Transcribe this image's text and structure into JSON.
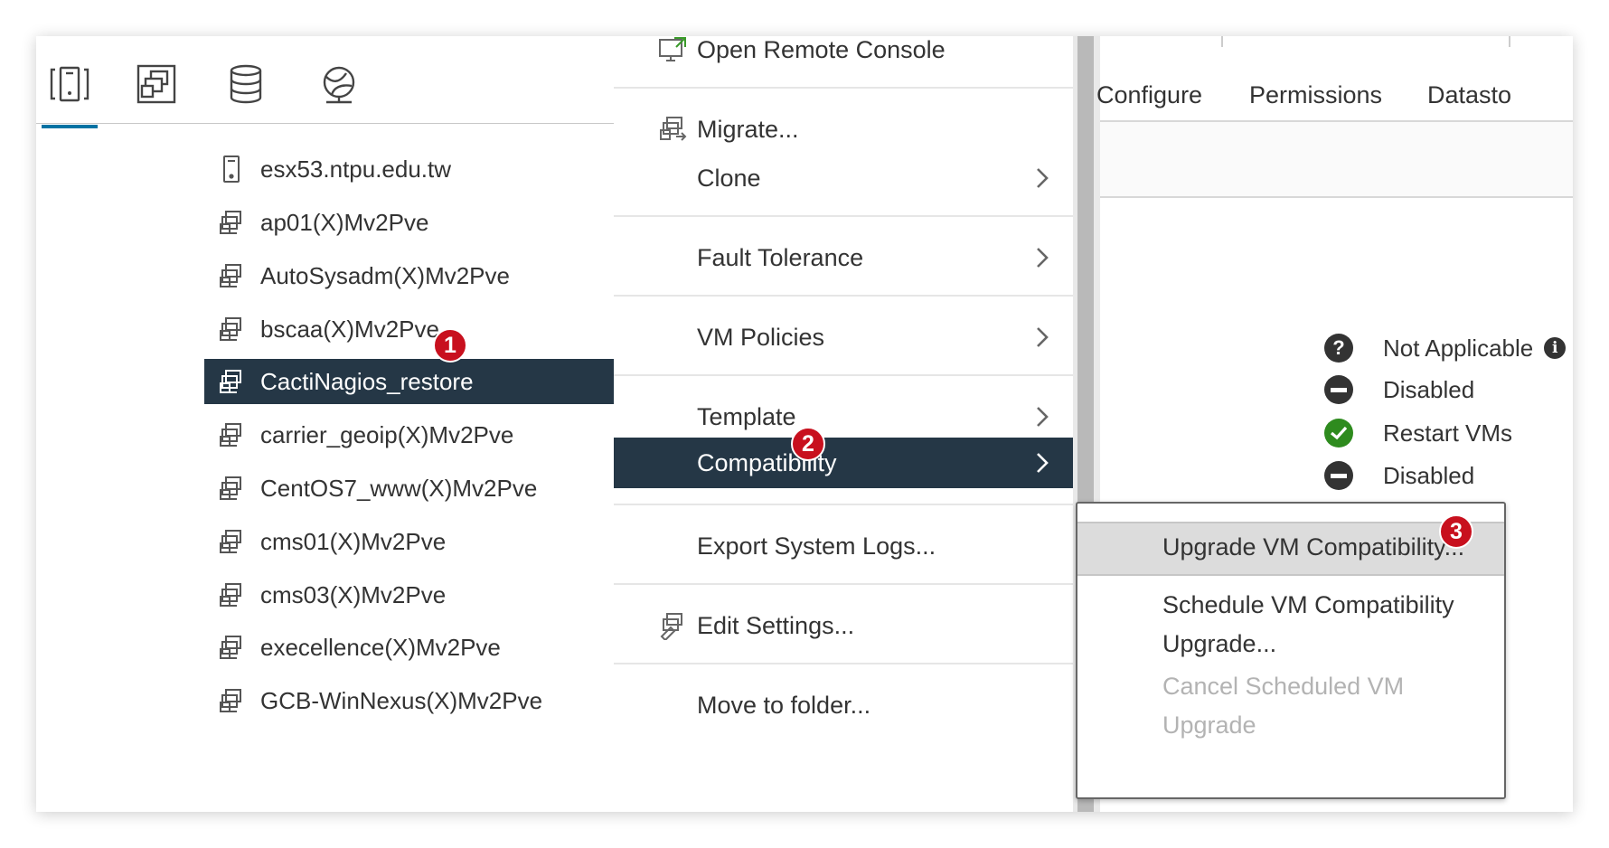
{
  "navigator": {
    "tabs": [
      {
        "name": "hosts-and-clusters",
        "icon": "hosts-clusters-icon"
      },
      {
        "name": "vms-and-templates",
        "icon": "vms-templates-icon"
      },
      {
        "name": "storage",
        "icon": "database-icon"
      },
      {
        "name": "networking",
        "icon": "network-icon"
      }
    ],
    "items": [
      {
        "label": "esx53.ntpu.edu.tw",
        "icon": "host-icon"
      },
      {
        "label": "ap01(X)Mv2Pve",
        "icon": "vm-icon"
      },
      {
        "label": "AutoSysadm(X)Mv2Pve",
        "icon": "vm-icon"
      },
      {
        "label": "bscaa(X)Mv2Pve",
        "icon": "vm-icon"
      },
      {
        "label": "CactiNagios_restore",
        "icon": "vm-icon",
        "selected": true
      },
      {
        "label": "carrier_geoip(X)Mv2Pve",
        "icon": "vm-icon"
      },
      {
        "label": "CentOS7_www(X)Mv2Pve",
        "icon": "vm-icon"
      },
      {
        "label": "cms01(X)Mv2Pve",
        "icon": "vm-icon"
      },
      {
        "label": "cms03(X)Mv2Pve",
        "icon": "vm-icon"
      },
      {
        "label": "execellence(X)Mv2Pve",
        "icon": "vm-icon"
      },
      {
        "label": "GCB-WinNexus(X)Mv2Pve",
        "icon": "vm-icon"
      }
    ]
  },
  "context_menu": {
    "items": [
      {
        "label": "Open Remote Console",
        "icon": "remote-console-icon"
      },
      {
        "label": "Migrate...",
        "icon": "migrate-icon"
      },
      {
        "label": "Clone",
        "submenu": true
      },
      {
        "label": "Fault Tolerance",
        "submenu": true
      },
      {
        "label": "VM Policies",
        "submenu": true
      },
      {
        "label": "Template",
        "submenu": true
      },
      {
        "label": "Compatibility",
        "submenu": true,
        "active": true
      },
      {
        "label": "Export System Logs..."
      },
      {
        "label": "Edit Settings...",
        "icon": "edit-settings-icon"
      },
      {
        "label": "Move to folder..."
      }
    ]
  },
  "submenu": {
    "items": [
      {
        "label": "Upgrade VM Compatibility...",
        "state": "hover"
      },
      {
        "label_line1": "Schedule VM Compatibility",
        "label_line2": "Upgrade...",
        "state": "enabled"
      },
      {
        "label_line1": "Cancel Scheduled VM",
        "label_line2": "Upgrade",
        "state": "disabled"
      }
    ]
  },
  "content": {
    "tabs": [
      "Configure",
      "Permissions",
      "Datasto"
    ],
    "statuses": [
      {
        "label": "Not Applicable",
        "icon": "question-icon",
        "color": "#333333"
      },
      {
        "label": "Disabled",
        "icon": "minus-icon",
        "color": "#333333"
      },
      {
        "label": "Restart VMs",
        "icon": "check-icon",
        "color": "#2e8b1e"
      },
      {
        "label": "Disabled",
        "icon": "minus-icon",
        "color": "#333333"
      }
    ]
  },
  "badges": [
    "1",
    "2",
    "3"
  ],
  "colors": {
    "selection": "#253746",
    "accent": "#0072a3",
    "badge": "#c8101e",
    "success": "#2e8b1e"
  }
}
